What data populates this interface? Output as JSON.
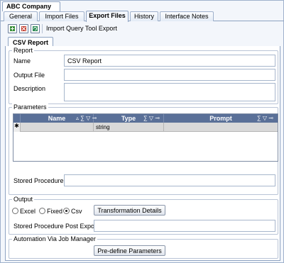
{
  "window": {
    "company": "ABC Company"
  },
  "tabs": [
    {
      "label": "General"
    },
    {
      "label": "Import Files"
    },
    {
      "label": "Export Files"
    },
    {
      "label": "History"
    },
    {
      "label": "Interface Notes"
    }
  ],
  "active_tab": "Export Files",
  "toolbar": {
    "icons": [
      "new-icon",
      "delete-icon",
      "refresh-icon"
    ],
    "import_label": "Import Query Tool Export"
  },
  "subtab": {
    "label": "CSV Report"
  },
  "report": {
    "group_label": "Report",
    "name_label": "Name",
    "name_value": "CSV Report",
    "output_file_label": "Output File",
    "output_file_value": "",
    "description_label": "Description",
    "description_value": ""
  },
  "parameters": {
    "group_label": "Parameters",
    "columns": [
      {
        "label": "Name",
        "icons": "▵ ∑ ▽ ⊸"
      },
      {
        "label": "Type",
        "icons": "∑ ▽ ⊸"
      },
      {
        "label": "Prompt",
        "icons": "∑ ▽ ⊸"
      }
    ],
    "rows": [
      {
        "indicator": "✱",
        "name": "",
        "type": "string",
        "prompt": ""
      }
    ],
    "stored_procedure_label": "Stored Procedure",
    "stored_procedure_value": ""
  },
  "output": {
    "group_label": "Output",
    "options": [
      {
        "label": "Excel",
        "selected": false
      },
      {
        "label": "Fixed",
        "selected": false
      },
      {
        "label": "Csv",
        "selected": true
      }
    ],
    "transformation_button": "Transformation Details",
    "post_export_label": "Stored Procedure Post Export",
    "post_export_value": ""
  },
  "automation": {
    "group_label": "Automation Via Job Manager",
    "predefine_button": "Pre-define Parameters"
  }
}
